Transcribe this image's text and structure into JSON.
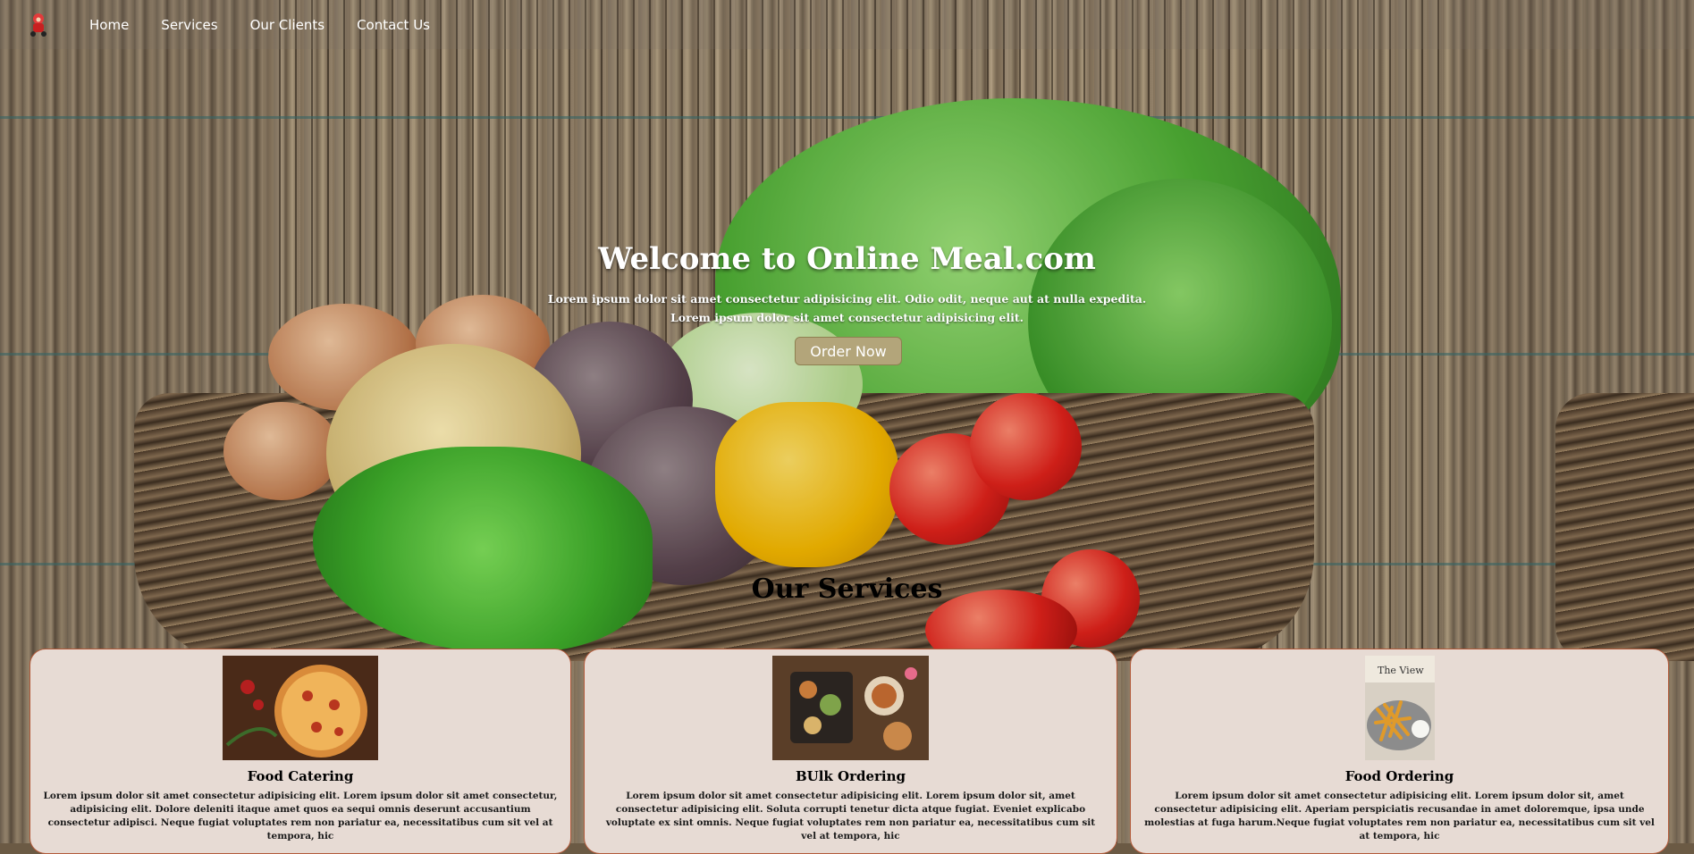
{
  "nav": {
    "logo_icon": "chef-mascot-icon",
    "items": [
      {
        "label": "Home"
      },
      {
        "label": "Services"
      },
      {
        "label": "Our Clients"
      },
      {
        "label": "Contact Us"
      }
    ]
  },
  "hero": {
    "title": "Welcome to Online Meal.com",
    "subtitle_line1": "Lorem ipsum dolor sit amet consectetur adipisicing elit. Odio odit, neque aut at nulla expedita.",
    "subtitle_line2": "Lorem ipsum dolor sit amet consectetur adipisicing elit.",
    "cta_label": "Order Now"
  },
  "services": {
    "title": "Our Services",
    "cards": [
      {
        "image": "pizza-photo",
        "title": "Food Catering",
        "text": "Lorem ipsum dolor sit amet consectetur adipisicing elit. Lorem ipsum dolor sit amet consectetur, adipisicing elit. Dolore deleniti itaque amet quos ea sequi omnis deserunt accusantium consectetur adipisci. Neque fugiat voluptates rem non pariatur ea, necessitatibus cum sit vel at tempora, hic"
      },
      {
        "image": "platter-photo",
        "title": "BUlk Ordering",
        "text": "Lorem ipsum dolor sit amet consectetur adipisicing elit. Lorem ipsum dolor sit, amet consectetur adipisicing elit. Soluta corrupti tenetur dicta atque fugiat. Eveniet explicabo voluptate ex sint omnis. Neque fugiat voluptates rem non pariatur ea, necessitatibus cum sit vel at tempora, hic"
      },
      {
        "image": "fries-photo",
        "title": "Food Ordering",
        "text": "Lorem ipsum dolor sit amet consectetur adipisicing elit. Lorem ipsum dolor sit, amet consectetur adipisicing elit. Aperiam perspiciatis recusandae in amet doloremque, ipsa unde molestias at fuga harum.Neque fugiat voluptates rem non pariatur ea, necessitatibus cum sit vel at tempora, hic"
      }
    ]
  }
}
